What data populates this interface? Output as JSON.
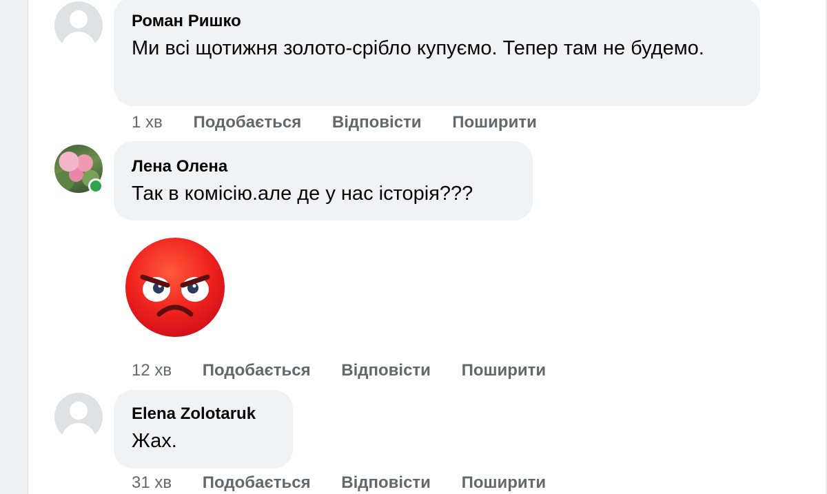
{
  "comments": [
    {
      "author": "Роман Ришко",
      "text": "Ми всі щотижня золото-срібло купуємо. Тепер там не будемо.",
      "time": "1 хв",
      "actions": {
        "like": "Подобається",
        "reply": "Відповісти",
        "share": "Поширити"
      },
      "avatar": "default-avatar-icon"
    },
    {
      "author": "Лена Олена",
      "text": "Так в комісію.але де у нас історія???",
      "sticker": "angry-face-emoji",
      "time": "12 хв",
      "actions": {
        "like": "Подобається",
        "reply": "Відповісти",
        "share": "Поширити"
      },
      "avatar": "flower-photo",
      "online": true
    },
    {
      "author": "Elena Zolotaruk",
      "text": "Жах.",
      "time": "31 хв",
      "actions": {
        "like": "Подобається",
        "reply": "Відповісти",
        "share": "Поширити"
      },
      "avatar": "default-avatar-icon"
    }
  ],
  "colors": {
    "bubble": "#f0f2f5",
    "meta_text": "#65676b",
    "online": "#31a24c",
    "angry_red": "#f0241e"
  }
}
